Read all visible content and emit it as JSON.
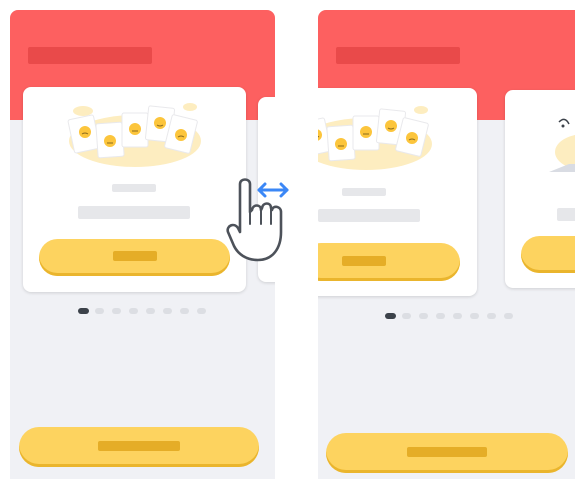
{
  "screens": [
    {
      "id": "before-swipe",
      "active_dot": 0,
      "dot_count": 8
    },
    {
      "id": "after-swipe",
      "active_dot": 0,
      "dot_count": 8
    }
  ],
  "gesture": {
    "icon": "hand-swipe-icon",
    "arrow": "horizontal-arrow-icon"
  },
  "colors": {
    "header": "#fd6060",
    "header_title": "#e94a4a",
    "button": "#fdd35f",
    "button_label": "#e5ad27",
    "background": "#f0f1f5",
    "arrow": "#3b87f6",
    "active_dot": "#3c424a"
  }
}
